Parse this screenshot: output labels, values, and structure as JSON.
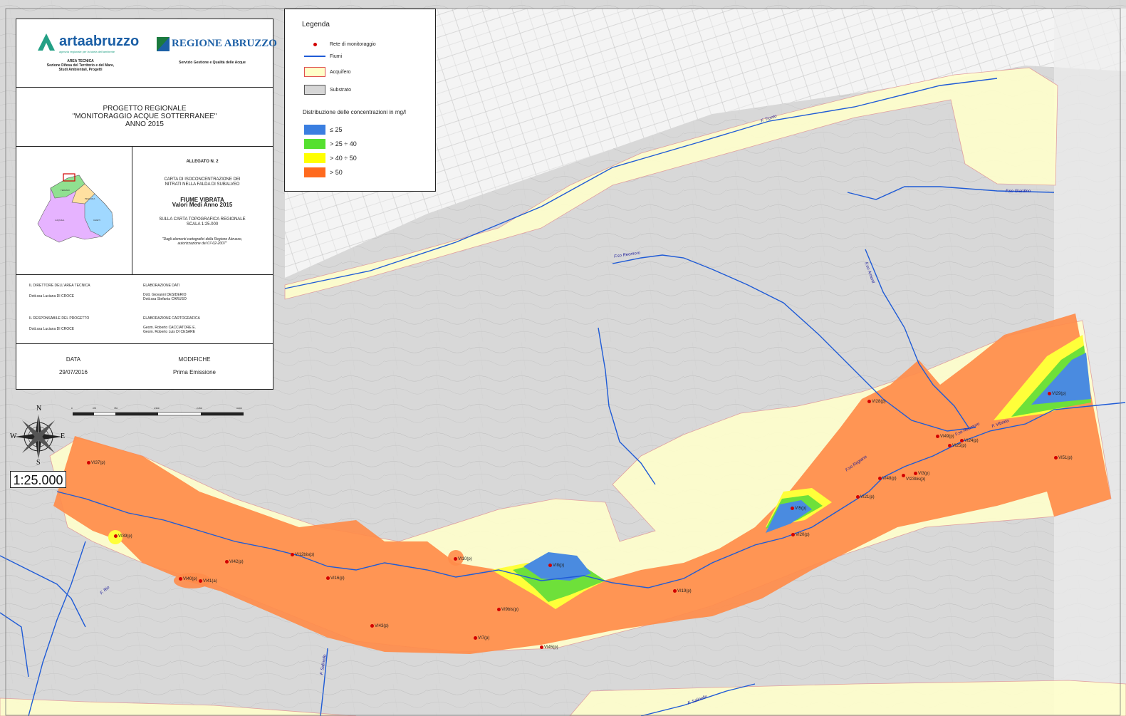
{
  "legend": {
    "title": "Legenda",
    "items": [
      {
        "label": "Rete di monitoraggio",
        "symbol": "station-dot"
      },
      {
        "label": "Fiumi",
        "symbol": "river-line"
      },
      {
        "label": "Acquifero",
        "symbol": "fill",
        "color": "#ffffc8",
        "border": "#e05050"
      },
      {
        "label": "Substrato",
        "symbol": "fill",
        "color": "#d6d6d6",
        "border": "#555"
      }
    ],
    "distribution_title": "Distribuzione delle concentrazioni in mg/l",
    "classes": [
      {
        "label": "≤ 25",
        "color": "#3a7ee0"
      },
      {
        "label": "> 25 ÷ 40",
        "color": "#55e030"
      },
      {
        "label": "> 40 ÷ 50",
        "color": "#ffff00"
      },
      {
        "label": "> 50",
        "color": "#ff6a1e"
      }
    ]
  },
  "title_block": {
    "arta_logo": "artaabruzzo",
    "arta_tagline": "agenzia regionale per la tutela dell'ambiente",
    "regione_logo": "REGIONE ABRUZZO",
    "area_tecnica": "AREA TECNICA",
    "sezione": "Sezione Difesa del Territorio e del Mare,",
    "studi": "Studi Ambientali, Progetti",
    "servizio": "Servizio Gestione e Qualità delle Acque",
    "progetto_l1": "PROGETTO REGIONALE",
    "progetto_l2": "\"MONITORAGGIO ACQUE SOTTERRANEE\"",
    "progetto_l3": "ANNO 2015",
    "allegato": "ALLEGATO N. 2",
    "carta_l1": "CARTA DI ISOCONCENTRAZIONE DEI",
    "carta_l2": "NITRATI NELLA FALDA DI SUBALVEO",
    "fiume": "FIUME VIBRATA",
    "valori": "Valori Medi Anno 2015",
    "sulla_l1": "SULLA CARTA TOPOGRAFICA REGIONALE",
    "sulla_l2": "SCALA 1:25.000",
    "note_l1": "\"Dagli elementi cartografici della Regione Abruzzo,",
    "note_l2": "autorizzazione del 07-02-2007\"",
    "dir_label": "IL DIRETTORE DELL'AREA TECNICA",
    "dir_name": "Dott.ssa Luciana DI CROCE",
    "resp_label": "IL RESPONSABILE DEL PROGETTO",
    "resp_name": "Dott.ssa Luciana DI CROCE",
    "elab_dati": "ELABORAZIONE DATI",
    "elab_dati_n1": "Dott. Giovanni DESIDERIO",
    "elab_dati_n2": "Dott.ssa Stefania CARUSO",
    "elab_carto": "ELABORAZIONE CARTOGRAFICA",
    "elab_carto_n1": "Geom. Roberto CACCIATORE E.",
    "elab_carto_n2": "Geom. Roberto Luis DI CESARE",
    "data_label": "DATA",
    "data_value": "29/07/2016",
    "modifiche_label": "MODIFICHE",
    "modifiche_value": "Prima Emissione",
    "inset_labels": [
      "TERAMO",
      "PESCARA",
      "CHIETI",
      "L'AQUILA"
    ]
  },
  "compass": {
    "n": "N",
    "s": "S",
    "e": "E",
    "w": "W"
  },
  "scale_text": "1:25.000",
  "scalebar_ticks": [
    "0",
    "375",
    "750",
    "1.500",
    "2.250",
    "3.000"
  ],
  "rivers": [
    "F. Tronto",
    "F.so Giardino",
    "F.so Reomoro",
    "F.so Amenti",
    "F. Vibrata",
    "F.so Reomoro",
    "F.so Regiano",
    "F. Rio",
    "F. Salinello",
    "F. Salinello"
  ],
  "stations": [
    "VI37(p)",
    "VI39(p)",
    "VI40(p)",
    "VI41(a)",
    "VI42(p)",
    "VI12bis(p)",
    "VI16(p)",
    "VI43(p)",
    "VI10(p)",
    "VI8(p)",
    "VI9bis(p)",
    "VI7(p)",
    "VI45(p)",
    "VI19(p)",
    "VI20(p)",
    "VI5(p)",
    "VI21(p)",
    "VI48(p)",
    "VI3(p)",
    "VI23bis(p)",
    "VI28(p)",
    "VI49(p)",
    "VI24(p)",
    "VI25(p)",
    "VI29(p)",
    "VI51(p)"
  ]
}
